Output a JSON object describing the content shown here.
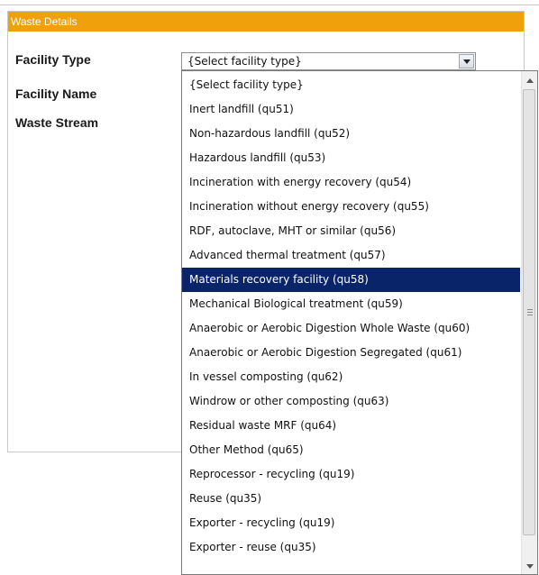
{
  "panel": {
    "title": "Waste Details"
  },
  "labels": {
    "facility_type": "Facility Type",
    "facility_name": "Facility Name",
    "waste_stream": "Waste Stream"
  },
  "select": {
    "value": "{Select facility type}",
    "options": [
      "{Select facility type}",
      "Inert landfill (qu51)",
      "Non-hazardous landfill (qu52)",
      "Hazardous landfill (qu53)",
      "Incineration with energy recovery (qu54)",
      "Incineration without energy recovery (qu55)",
      "RDF, autoclave, MHT or similar (qu56)",
      "Advanced thermal treatment (qu57)",
      "Materials recovery facility (qu58)",
      "Mechanical Biological treatment (qu59)",
      "Anaerobic or Aerobic Digestion Whole Waste (qu60)",
      "Anaerobic or Aerobic Digestion Segregated (qu61)",
      "In vessel composting (qu62)",
      "Windrow or other composting (qu63)",
      "Residual waste MRF (qu64)",
      "Other Method (qu65)",
      "Reprocessor - recycling (qu19)",
      "Reuse (qu35)",
      "Exporter - recycling (qu19)",
      "Exporter - reuse (qu35)"
    ],
    "highlighted_index": 8
  },
  "colors": {
    "header": "#f0a00a",
    "highlight": "#0a246a"
  }
}
